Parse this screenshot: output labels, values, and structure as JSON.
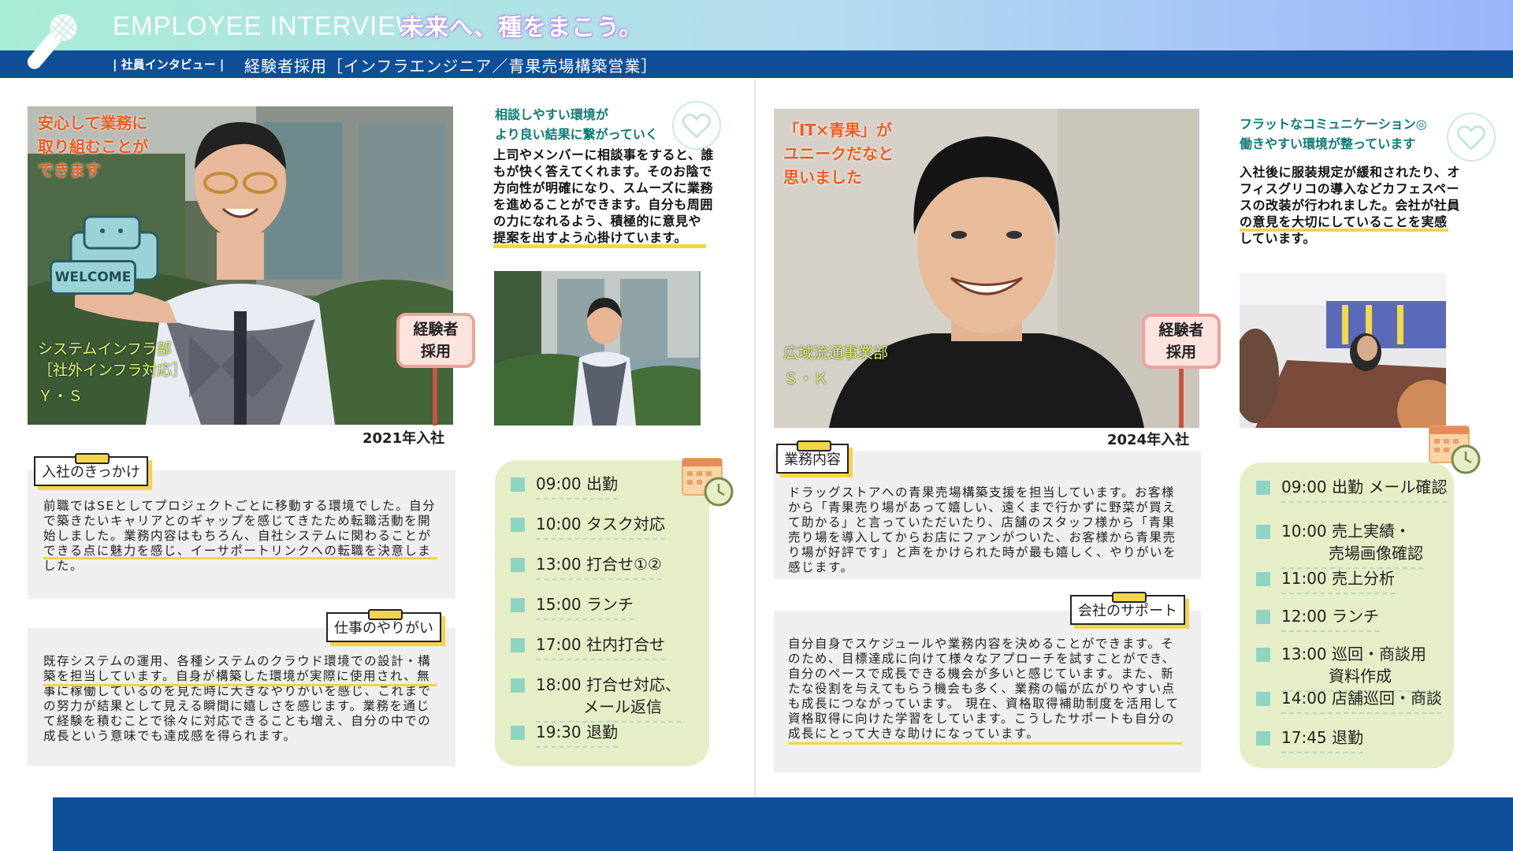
{
  "header": {
    "title_en": "EMPLOYEE INTERVIEW",
    "title_jp": "未来へ、種をまこう。",
    "crumb": "| 社員インタビュー |",
    "page_title": "経験者採用［インフラエンジニア／青果売場構築営業］"
  },
  "left": {
    "photo_catch": [
      "安心して業務に",
      "取り組むことが",
      "できます"
    ],
    "welcome_board": "WELCOME",
    "dept": [
      "システムインフラ部",
      "［社外インフラ対応］"
    ],
    "name": "Ｙ・Ｓ",
    "sign": [
      "経験者",
      "採用"
    ],
    "year": "2021年入社",
    "side_head": [
      "相談しやすい環境が",
      "より良い結果に繋がっていく"
    ],
    "side_body": "上司やメンバーに相談事をすると、誰もが快く答えてくれます。そのお陰で方向性が明確になり、スムーズに業務を進めることができます。自分も周囲の力になれるよう、積極的に意見や提案を出すよう心掛けています。",
    "tag1": "入社のきっかけ",
    "text1": "前職ではSEとしてプロジェクトごとに移動する環境でした。自分で築きたいキャリアとのギャップを感じてきたため転職活動を開始しました。業務内容はもちろん、自社システムに関わることができる点に魅力を感じ、イーサポートリンクへの転職を決意しました。",
    "tag2": "仕事のやりがい",
    "text2": "既存システムの運用、各種システムのクラウド環境での設計・構築を担当しています。自身が構築した環境が実際に使用され、無事に稼働しているのを見た時に大きなやりがいを感じ、これまでの努力が結果として見える瞬間に嬉しさを感じます。業務を通じて経験を積むことで徐々に対応できることも増え、自分の中での成長という意味でも達成感を得られます。",
    "schedule": [
      "09:00 出勤",
      "10:00 タスク対応",
      "13:00 打合せ①②",
      "15:00 ランチ",
      "17:00 社内打合せ",
      "18:00 打合せ対応、\n　　　メール返信",
      "19:30 退勤"
    ]
  },
  "right": {
    "photo_catch": [
      "「IT×青果」が",
      "ユニークだなと",
      "思いました"
    ],
    "dept": [
      "広域流通事業部"
    ],
    "name": "Ｓ・Ｋ",
    "sign": [
      "経験者",
      "採用"
    ],
    "year": "2024年入社",
    "side_head": [
      "フラットなコミュニケーション◎",
      "働きやすい環境が整っています"
    ],
    "side_body": "入社後に服装規定が緩和されたり、オフィスグリコの導入などカフェスペースの改装が行われました。会社が社員の意見を大切にしていることを実感しています。",
    "tag1": "業務内容",
    "text1": "ドラッグストアへの青果売場構築支援を担当しています。お客様から「青果売り場があって嬉しい、遠くまで行かずに野菜が買えて助かる」と言っていただいたり、店舗のスタッフ様から「青果売り場を導入してからお店にファンがついた、お客様から青果売り場が好評です」と声をかけられた時が最も嬉しく、やりがいを感じます。",
    "tag2": "会社のサポート",
    "text2": "自分自身でスケジュールや業務内容を決めることができます。そのため、目標達成に向けて様々なアプローチを試すことができ、自分のペースで成長できる機会が多いと感じています。また、新たな役割を与えてもらう機会も多く、業務の幅が広がりやすい点も成長につながっています。\n現在、資格取得補助制度を活用して資格取得に向けた学習をしています。こうしたサポートも自分の成長にとって大きな助けになっています。",
    "schedule": [
      "09:00 出勤 メール確認",
      "10:00 売上実績・\n　　　売場画像確認",
      "11:00 売上分析",
      "12:00 ランチ",
      "13:00 巡回・商談用\n　　　資料作成",
      "14:00 店舗巡回・商談",
      "17:45 退勤"
    ]
  },
  "colors": {
    "navy": "#0e4f98",
    "orange": "#f25a1c",
    "teal": "#0e7a73",
    "yellow": "#f3d44a",
    "schedule_bg": "#e6eec7"
  },
  "icons": [
    "microphone-icon",
    "heart-icon",
    "calendar-clock-icon"
  ]
}
